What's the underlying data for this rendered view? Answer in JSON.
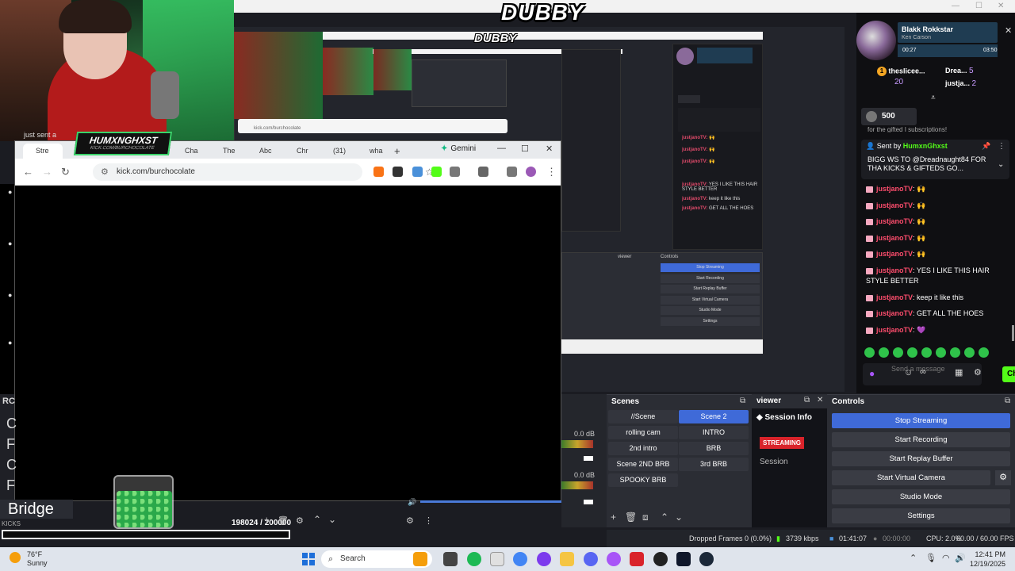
{
  "stream_overlay": {
    "logo": "DUBBY",
    "nested_logo": "DUBBY",
    "sent_a": "just sent a",
    "channel_logo": "HUMXNGHXST",
    "channel_logo_sub": "KICK.COM/BURCHOCOLATE"
  },
  "nested": {
    "url": "kick.com/burchocolate",
    "chat_lines": [
      {
        "user": "justjanoTV:",
        "text": "🙌"
      },
      {
        "user": "justjanoTV:",
        "text": "🙌"
      },
      {
        "user": "justjanoTV:",
        "text": "🙌"
      },
      {
        "user": "justjanoTV:",
        "text": "YES I LIKE THIS HAIR STYLE BETTER"
      },
      {
        "user": "justjanoTV:",
        "text": "keep it like this"
      },
      {
        "user": "justjanoTV:",
        "text": "GET ALL THE HOES"
      }
    ],
    "obs_buttons": [
      "Stop Streaming",
      "Start Recording",
      "Start Replay Buffer",
      "Start Virtual Camera",
      "Studio Mode",
      "Settings"
    ],
    "obs_headers": [
      "viewer",
      "Controls"
    ]
  },
  "browser": {
    "tabs": [
      {
        "label": "Stre",
        "color": "#53fc18"
      },
      {
        "label": "",
        "color": "#53fc18"
      },
      {
        "label": "Cha",
        "color": "#ff0000"
      },
      {
        "label": "The",
        "color": "#ff0000"
      },
      {
        "label": "Abc",
        "color": "#a855f7"
      },
      {
        "label": "Chr",
        "color": "#4285f4"
      },
      {
        "label": "(31)",
        "color": "#111111"
      },
      {
        "label": "wha",
        "color": "#4285f4"
      }
    ],
    "new_tab": "+",
    "gemini_label": "Gemini",
    "url": "kick.com/burchocolate",
    "minimize": "—",
    "maximize": "☐",
    "close": "✕"
  },
  "left_overlay": {
    "rc": "RC",
    "letters": [
      "C",
      "F",
      "C",
      "F"
    ],
    "bridge": "Bridge",
    "kicks": "KICKS"
  },
  "goal": {
    "current": "198024",
    "target": "/ 200000"
  },
  "mixer": {
    "levels": [
      "0.0 dB",
      "0.0 dB"
    ]
  },
  "scenes": {
    "title": "Scenes",
    "items": [
      {
        "label": "//Scene",
        "active": false
      },
      {
        "label": "Scene 2",
        "active": true
      },
      {
        "label": "rolling cam",
        "active": false
      },
      {
        "label": "INTRO",
        "active": false
      },
      {
        "label": "2nd intro",
        "active": false
      },
      {
        "label": "BRB",
        "active": false
      },
      {
        "label": "Scene 2ND BRB",
        "active": false
      },
      {
        "label": "3rd BRB",
        "active": false
      },
      {
        "label": "SPOOKY BRB",
        "active": false
      }
    ]
  },
  "viewer": {
    "title": "viewer",
    "session_info": "Session Info",
    "streaming": "STREAMING",
    "session": "Session"
  },
  "controls": {
    "title": "Controls",
    "buttons": [
      "Stop Streaming",
      "Start Recording",
      "Start Replay Buffer",
      "Start Virtual Camera",
      "Studio Mode",
      "Settings"
    ]
  },
  "status": {
    "dropped": "Dropped Frames 0 (0.0%)",
    "bitrate": "3739 kbps",
    "time": "01:41:07",
    "rec_time": "00:00:00",
    "cpu": "CPU: 2.0%",
    "fps": "60.00 / 60.00 FPS"
  },
  "chat": {
    "now_playing": {
      "title": "Blakk Rokkstar",
      "artist": "Ken Carson",
      "elapsed": "00:27",
      "duration": "03:50"
    },
    "leaderboard": [
      {
        "name": "theslicee...",
        "count": "20"
      },
      {
        "name": "Drea...",
        "count": "5"
      },
      {
        "name": "justja...",
        "count": "2"
      }
    ],
    "kicks": "500",
    "partial_line": "for the gifted I subscriptions!",
    "pinned": {
      "sent_by_label": "Sent by",
      "user": "HumxnGhxst",
      "message": "BIGG WS TO @Dreadnaught84 FOR THA KICKS & GIFTEDS GO..."
    },
    "messages": [
      {
        "user": "justjanoTV",
        "text": ": 🙌"
      },
      {
        "user": "justjanoTV",
        "text": ": 🙌"
      },
      {
        "user": "justjanoTV",
        "text": ": 🙌"
      },
      {
        "user": "justjanoTV",
        "text": ": 🙌"
      },
      {
        "user": "justjanoTV",
        "text": ": 🙌"
      },
      {
        "user": "justjanoTV",
        "text": ": YES I LIKE THIS HAIR STYLE BETTER"
      },
      {
        "user": "justjanoTV",
        "text": ": keep it like this"
      },
      {
        "user": "justjanoTV",
        "text": ": GET ALL THE HOES"
      },
      {
        "user": "justjanoTV",
        "text": ": 💜"
      }
    ],
    "send_placeholder": "Send a message",
    "chat_button": "Chat"
  },
  "taskbar": {
    "temp": "76°F",
    "condition": "Sunny",
    "search": "Search",
    "time": "12:41 PM",
    "date": "12/19/2025"
  },
  "colors": {
    "obs_blue": "#3f6ad8",
    "kick_green": "#53fc18",
    "streaming_red": "#d9232a",
    "chat_user": "#ff4d6d"
  }
}
